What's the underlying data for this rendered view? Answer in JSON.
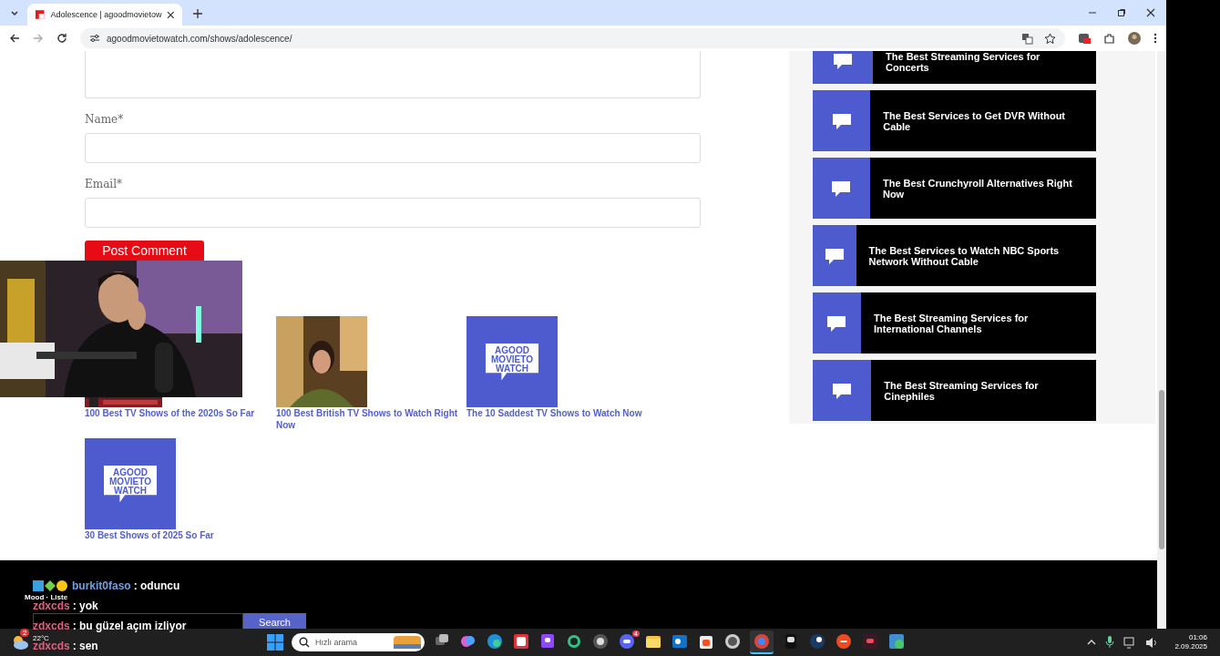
{
  "browser": {
    "tab": {
      "title": "Adolescence | agoodmovietow",
      "selected": true
    },
    "url": "agoodmovietowatch.com/shows/adolescence/"
  },
  "comment_form": {
    "fields": [
      {
        "label": "Name*"
      },
      {
        "label": "Email*"
      }
    ],
    "submit": "Post Comment"
  },
  "related": [
    {
      "kind": "picture",
      "title": "100 Best TV Shows of the 2020s So Far"
    },
    {
      "kind": "picture",
      "title": "100 Best British TV Shows to Watch Right Now"
    },
    {
      "kind": "logo",
      "logo_text": "AGOOD MOVIETO WATCH",
      "title": "The 10 Saddest TV Shows to Watch Now"
    },
    {
      "kind": "logo",
      "logo_text": "AGOOD MOVIETO WATCH",
      "title": "30 Best Shows of 2025 So Far"
    }
  ],
  "sidebar": {
    "cards": [
      {
        "title": "The Best Streaming Services for Concerts"
      },
      {
        "title": "The Best Services to Get DVR Without Cable"
      },
      {
        "title": "The Best Crunchyroll Alternatives Right Now"
      },
      {
        "title": "The Best Services to Watch NBC Sports Network Without Cable"
      },
      {
        "title": "The Best Streaming Services for International Channels"
      },
      {
        "title": "The Best Streaming Services for Cinephiles"
      }
    ]
  },
  "footer": {
    "search_button": "Search"
  },
  "chat": {
    "label": "Mood · Liste",
    "lines": [
      {
        "user": "burkit0faso",
        "message": ": oduncu",
        "color": "#6f9fe0",
        "badges": true
      },
      {
        "user": "zdxcds",
        "message": ": yok",
        "color": "#e0607f",
        "badges": false
      },
      {
        "user": "zdxcds",
        "message": ": bu güzel açım izliyor",
        "color": "#e0607f",
        "badges": false
      },
      {
        "user": "zdxcds",
        "message": ": sen",
        "color": "#e0607f",
        "badges": false
      }
    ]
  },
  "taskbar": {
    "weather_badge": "2",
    "temperature": "22°C",
    "search_placeholder": "Hızlı arama",
    "apps": [
      {
        "selected": false
      },
      {
        "selected": false
      },
      {
        "selected": false
      },
      {
        "selected": false
      },
      {
        "selected": false
      },
      {
        "selected": false
      },
      {
        "selected": false
      },
      {
        "selected": false,
        "badge": "4"
      },
      {
        "selected": false
      },
      {
        "selected": false
      },
      {
        "selected": false
      },
      {
        "selected": false
      },
      {
        "selected": true
      },
      {
        "selected": false
      },
      {
        "selected": false
      },
      {
        "selected": false
      },
      {
        "selected": false
      },
      {
        "selected": false
      }
    ],
    "time": "01:06",
    "date": "2.09.2025"
  }
}
